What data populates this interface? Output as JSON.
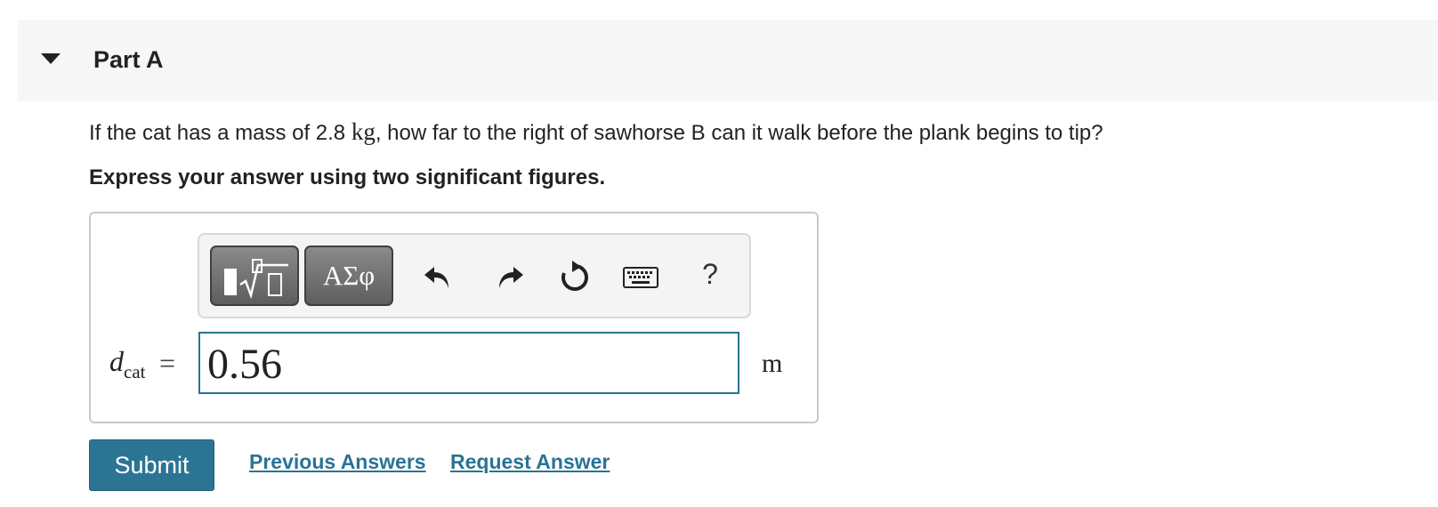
{
  "part": {
    "title": "Part A",
    "caret_icon": "caret-down-icon"
  },
  "question": {
    "text_before": "If the cat has a mass of 2.8 ",
    "unit": "kg",
    "text_after": ", how far to the right of sawhorse B can it walk before the plank begins to tip?"
  },
  "instruction": "Express your answer using two significant figures.",
  "toolbar": {
    "templates_icon": "templates-icon",
    "symbols_label": "ΑΣφ",
    "undo_icon": "undo-icon",
    "redo_icon": "redo-icon",
    "reset_icon": "reset-icon",
    "keyboard_icon": "keyboard-icon",
    "help_label": "?"
  },
  "answer": {
    "variable": "d",
    "subscript": "cat",
    "equals": "=",
    "value": "0.56",
    "unit": "m"
  },
  "actions": {
    "submit_label": "Submit",
    "previous_answers_label": "Previous Answers",
    "request_answer_label": "Request Answer"
  },
  "colors": {
    "accent": "#2c7494",
    "link": "#2a7394",
    "header_bg": "#f7f7f7"
  }
}
